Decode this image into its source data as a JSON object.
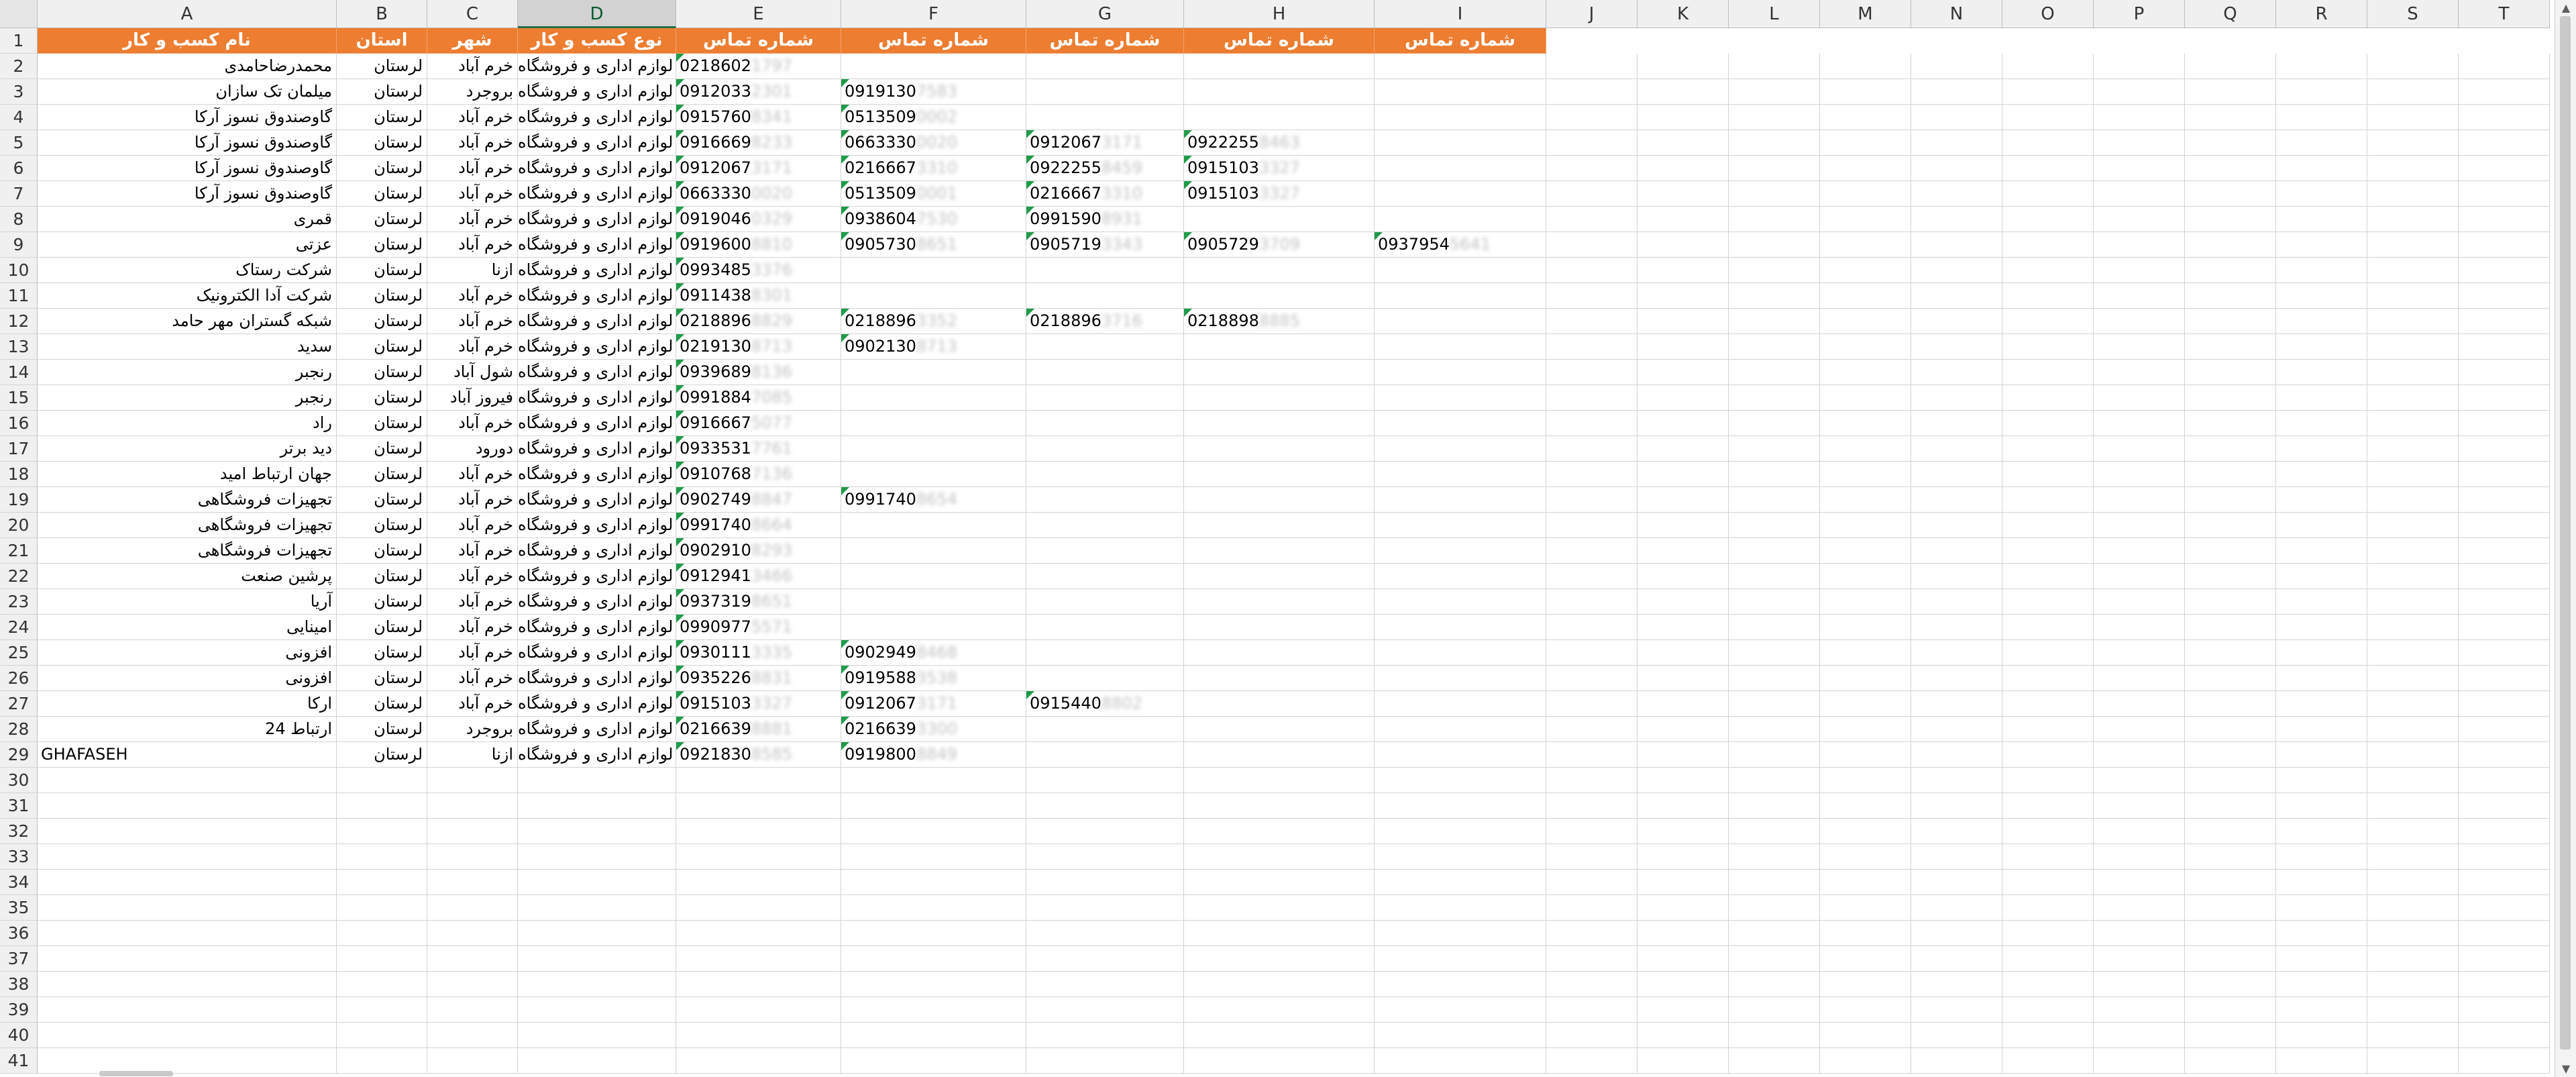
{
  "sheet": {
    "selected_column": "D",
    "columns": [
      "A",
      "B",
      "C",
      "D",
      "E",
      "F",
      "G",
      "H",
      "I",
      "J",
      "K",
      "L",
      "M",
      "N",
      "O",
      "P",
      "Q",
      "R",
      "S",
      "T"
    ],
    "row_numbers": [
      "1",
      "2",
      "3",
      "4",
      "5",
      "6",
      "7",
      "8",
      "9",
      "10",
      "11",
      "12",
      "13",
      "14",
      "15",
      "16",
      "17",
      "18",
      "19",
      "20",
      "21",
      "22",
      "23",
      "24",
      "25",
      "26",
      "27",
      "28",
      "29",
      "30",
      "31",
      "32",
      "33",
      "34",
      "35",
      "36",
      "37",
      "38",
      "39",
      "40",
      "41"
    ],
    "header_fill_color": "#ed7d31",
    "header_text_color": "#ffffff",
    "headers": {
      "A": "نام کسب و کار",
      "B": "استان",
      "C": "شهر",
      "D": "نوع کسب و کار",
      "E": "شماره تماس",
      "F": "شماره تماس",
      "G": "شماره تماس",
      "H": "شماره تماس",
      "I": "شماره تماس"
    },
    "rows": [
      {
        "name": "محمدرضاحامدی",
        "province": "لرستان",
        "city": "خرم آباد",
        "type": "لوازم اداری و فروشگاه",
        "phones": [
          [
            "0218602",
            "1797"
          ]
        ]
      },
      {
        "name": "میلمان تک سازان",
        "province": "لرستان",
        "city": "بروجرد",
        "type": "لوازم اداری و فروشگاه",
        "phones": [
          [
            "0912033",
            "2301"
          ],
          [
            "0919130",
            "7583"
          ]
        ]
      },
      {
        "name": "گاوصندوق نسوز آرکا",
        "province": "لرستان",
        "city": "خرم آباد",
        "type": "لوازم اداری و فروشگاه",
        "phones": [
          [
            "0915760",
            "8341"
          ],
          [
            "0513509",
            "0002"
          ]
        ]
      },
      {
        "name": "گاوصندوق نسوز آرکا",
        "province": "لرستان",
        "city": "خرم آباد",
        "type": "لوازم اداری و فروشگاه",
        "phones": [
          [
            "0916669",
            "8233"
          ],
          [
            "0663330",
            "0020"
          ],
          [
            "0912067",
            "3171"
          ],
          [
            "0922255",
            "8463"
          ]
        ]
      },
      {
        "name": "گاوصندوق نسوز آرکا",
        "province": "لرستان",
        "city": "خرم آباد",
        "type": "لوازم اداری و فروشگاه",
        "phones": [
          [
            "0912067",
            "3171"
          ],
          [
            "0216667",
            "3310"
          ],
          [
            "0922255",
            "8459"
          ],
          [
            "0915103",
            "3327"
          ]
        ]
      },
      {
        "name": "گاوصندوق نسوز آرکا",
        "province": "لرستان",
        "city": "خرم آباد",
        "type": "لوازم اداری و فروشگاه",
        "phones": [
          [
            "0663330",
            "0020"
          ],
          [
            "0513509",
            "0001"
          ],
          [
            "0216667",
            "3310"
          ],
          [
            "0915103",
            "3327"
          ]
        ]
      },
      {
        "name": "قمری",
        "province": "لرستان",
        "city": "خرم آباد",
        "type": "لوازم اداری و فروشگاه",
        "phones": [
          [
            "0919046",
            "0329"
          ],
          [
            "0938604",
            "7530"
          ],
          [
            "0991590",
            "8931"
          ]
        ]
      },
      {
        "name": "عزتی",
        "province": "لرستان",
        "city": "خرم آباد",
        "type": "لوازم اداری و فروشگاه",
        "phones": [
          [
            "0919600",
            "8810"
          ],
          [
            "0905730",
            "8651"
          ],
          [
            "0905719",
            "3343"
          ],
          [
            "0905729",
            "3709"
          ],
          [
            "0937954",
            "5641"
          ]
        ]
      },
      {
        "name": "شرکت رستاک",
        "province": "لرستان",
        "city": "ازنا",
        "type": "لوازم اداری و فروشگاه",
        "phones": [
          [
            "0993485",
            "3376"
          ]
        ]
      },
      {
        "name": "شرکت آدا الکترونیک",
        "province": "لرستان",
        "city": "خرم آباد",
        "type": "لوازم اداری و فروشگاه",
        "phones": [
          [
            "0911438",
            "8301"
          ]
        ]
      },
      {
        "name": "شبکه گستران مهر حامد",
        "province": "لرستان",
        "city": "خرم آباد",
        "type": "لوازم اداری و فروشگاه",
        "phones": [
          [
            "0218896",
            "8829"
          ],
          [
            "0218896",
            "3352"
          ],
          [
            "0218896",
            "3716"
          ],
          [
            "0218898",
            "8885"
          ]
        ]
      },
      {
        "name": "سدید",
        "province": "لرستان",
        "city": "خرم آباد",
        "type": "لوازم اداری و فروشگاه",
        "phones": [
          [
            "0219130",
            "8713"
          ],
          [
            "0902130",
            "8713"
          ]
        ]
      },
      {
        "name": "رنجبر",
        "province": "لرستان",
        "city": "شول آباد",
        "type": "لوازم اداری و فروشگاه",
        "phones": [
          [
            "0939689",
            "8136"
          ]
        ]
      },
      {
        "name": "رنجبر",
        "province": "لرستان",
        "city": "فیروز آباد",
        "type": "لوازم اداری و فروشگاه",
        "phones": [
          [
            "0991884",
            "7085"
          ]
        ]
      },
      {
        "name": "راد",
        "province": "لرستان",
        "city": "خرم آباد",
        "type": "لوازم اداری و فروشگاه",
        "phones": [
          [
            "0916667",
            "5077"
          ]
        ]
      },
      {
        "name": "دید برتر",
        "province": "لرستان",
        "city": "دورود",
        "type": "لوازم اداری و فروشگاه",
        "phones": [
          [
            "0933531",
            "7761"
          ]
        ]
      },
      {
        "name": "جهان ارتباط امید",
        "province": "لرستان",
        "city": "خرم آباد",
        "type": "لوازم اداری و فروشگاه",
        "phones": [
          [
            "0910768",
            "7136"
          ]
        ]
      },
      {
        "name": "تجهیزات فروشگاهی",
        "province": "لرستان",
        "city": "خرم آباد",
        "type": "لوازم اداری و فروشگاه",
        "phones": [
          [
            "0902749",
            "8847"
          ],
          [
            "0991740",
            "8654"
          ]
        ]
      },
      {
        "name": "تجهیزات فروشگاهی",
        "province": "لرستان",
        "city": "خرم آباد",
        "type": "لوازم اداری و فروشگاه",
        "phones": [
          [
            "0991740",
            "8664"
          ]
        ]
      },
      {
        "name": "تجهیزات فروشگاهی",
        "province": "لرستان",
        "city": "خرم آباد",
        "type": "لوازم اداری و فروشگاه",
        "phones": [
          [
            "0902910",
            "8293"
          ]
        ]
      },
      {
        "name": "پرشین صنعت",
        "province": "لرستان",
        "city": "خرم آباد",
        "type": "لوازم اداری و فروشگاه",
        "phones": [
          [
            "0912941",
            "3466"
          ]
        ]
      },
      {
        "name": "آریا",
        "province": "لرستان",
        "city": "خرم آباد",
        "type": "لوازم اداری و فروشگاه",
        "phones": [
          [
            "0937319",
            "8651"
          ]
        ]
      },
      {
        "name": "امینایی",
        "province": "لرستان",
        "city": "خرم آباد",
        "type": "لوازم اداری و فروشگاه",
        "phones": [
          [
            "0990977",
            "5571"
          ]
        ]
      },
      {
        "name": "افزونی",
        "province": "لرستان",
        "city": "خرم آباد",
        "type": "لوازم اداری و فروشگاه",
        "phones": [
          [
            "0930111",
            "3335"
          ],
          [
            "0902949",
            "8468"
          ]
        ]
      },
      {
        "name": "افزونی",
        "province": "لرستان",
        "city": "خرم آباد",
        "type": "لوازم اداری و فروشگاه",
        "phones": [
          [
            "0935226",
            "8831"
          ],
          [
            "0919588",
            "3538"
          ]
        ]
      },
      {
        "name": "ارکا",
        "province": "لرستان",
        "city": "خرم آباد",
        "type": "لوازم اداری و فروشگاه",
        "phones": [
          [
            "0915103",
            "3327"
          ],
          [
            "0912067",
            "3171"
          ],
          [
            "0915440",
            "8802"
          ]
        ]
      },
      {
        "name": "ارتباط 24",
        "province": "لرستان",
        "city": "بروجرد",
        "type": "لوازم اداری و فروشگاه",
        "phones": [
          [
            "0216639",
            "8881"
          ],
          [
            "0216639",
            "3300"
          ]
        ]
      },
      {
        "name": "GHAFASEH",
        "province": "لرستان",
        "city": "ازنا",
        "type": "لوازم اداری و فروشگاه",
        "phones": [
          [
            "0921830",
            "8585"
          ],
          [
            "0919800",
            "8849"
          ]
        ]
      }
    ]
  },
  "scrollbar": {
    "up_icon": "▲",
    "down_icon": "▼"
  }
}
